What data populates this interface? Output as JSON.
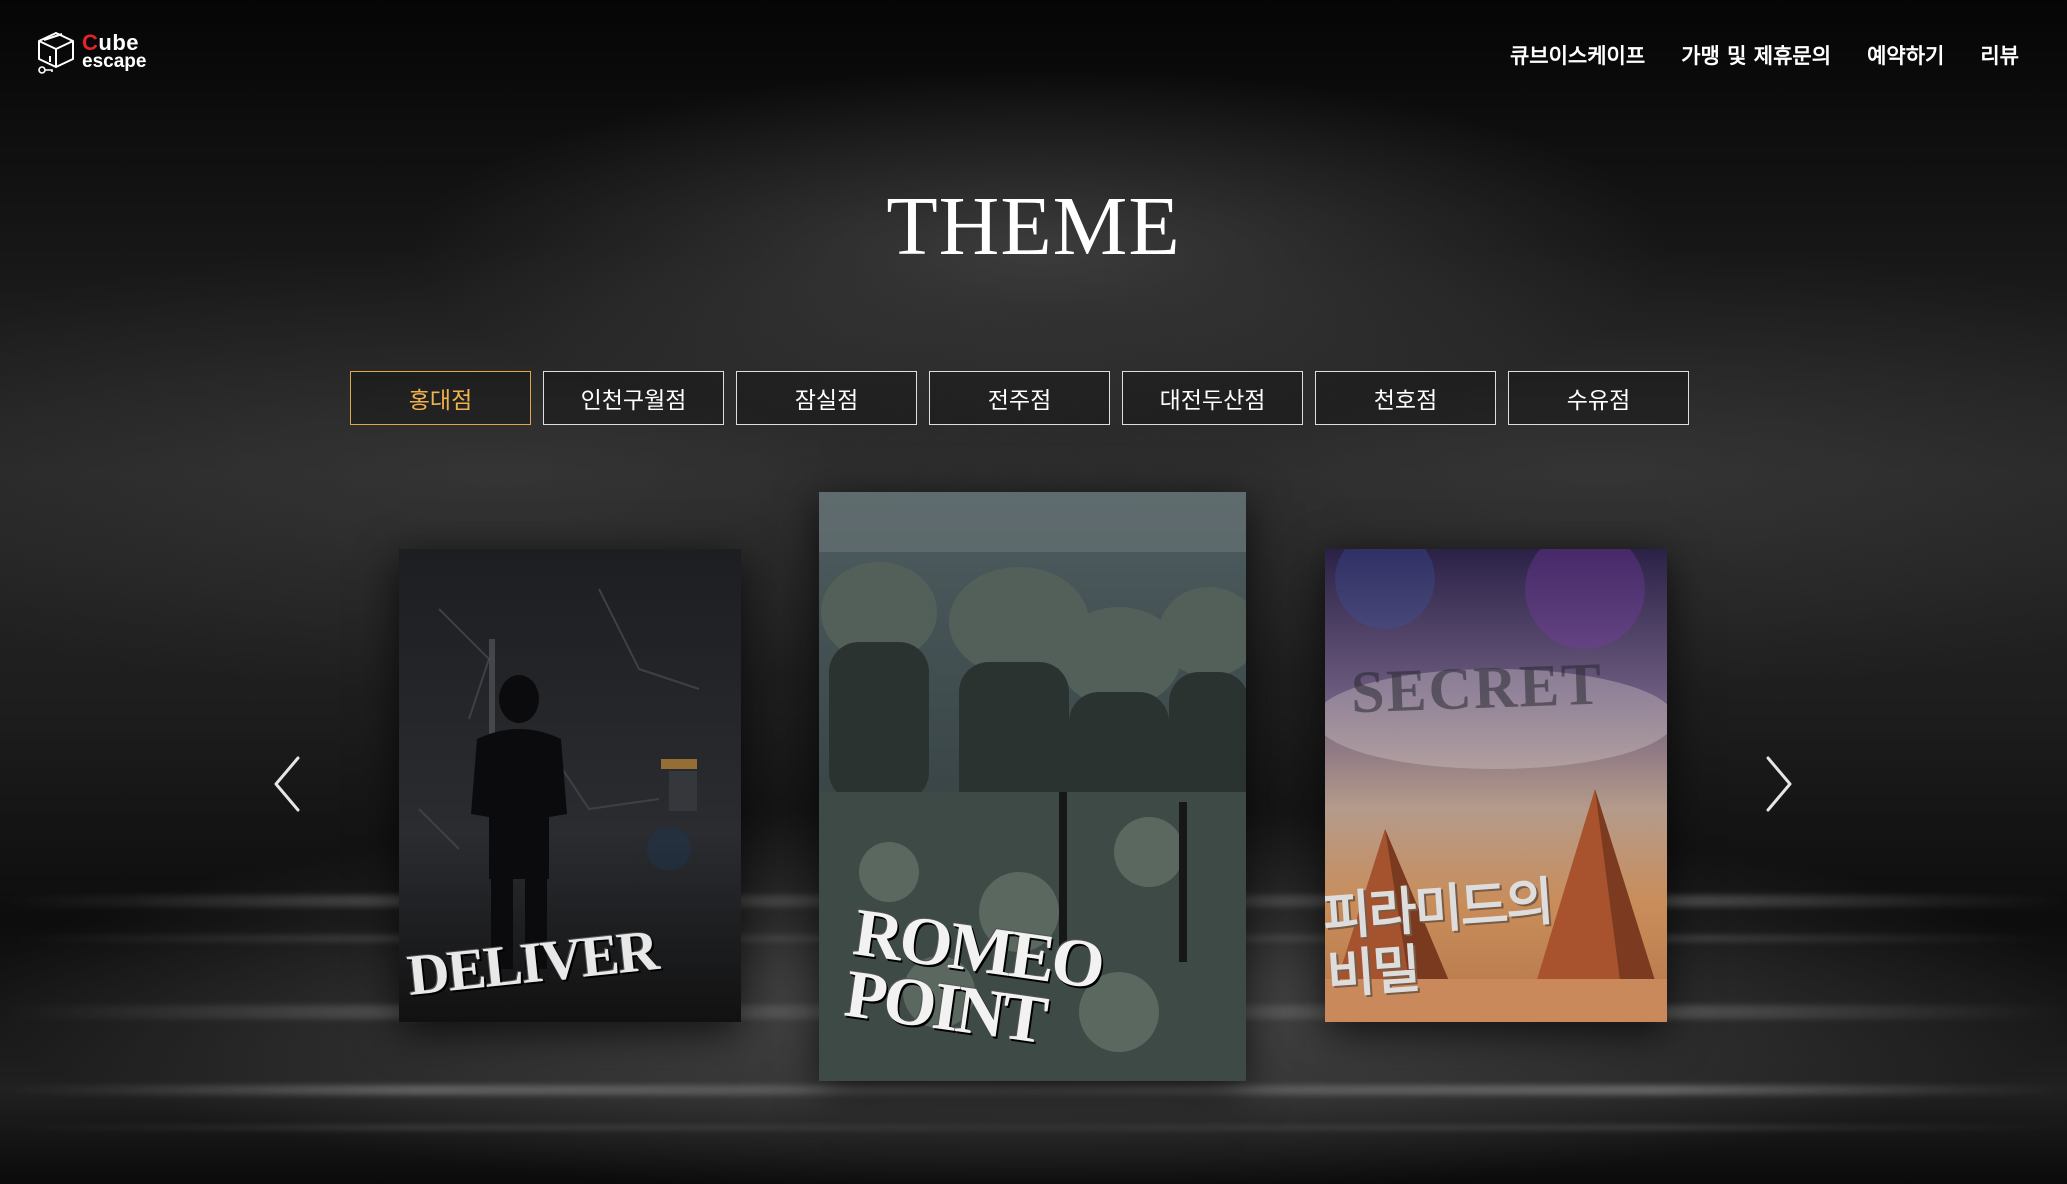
{
  "header": {
    "logo": {
      "line1": "Cube",
      "line2": "escape"
    },
    "nav": [
      {
        "label": "큐브이스케이프"
      },
      {
        "label": "가맹 및 제휴문의"
      },
      {
        "label": "예약하기"
      },
      {
        "label": "리뷰"
      }
    ]
  },
  "main": {
    "title": "THEME",
    "branches": [
      {
        "label": "홍대점",
        "active": true
      },
      {
        "label": "인천구월점",
        "active": false
      },
      {
        "label": "잠실점",
        "active": false
      },
      {
        "label": "전주점",
        "active": false
      },
      {
        "label": "대전두산점",
        "active": false
      },
      {
        "label": "천호점",
        "active": false
      },
      {
        "label": "수유점",
        "active": false
      }
    ],
    "carousel": {
      "prev_icon": "chevron-left-icon",
      "next_icon": "chevron-right-icon",
      "posters": [
        {
          "title": "DELIVER",
          "position": "left"
        },
        {
          "title": "ROMEO\nPOINT",
          "position": "center"
        },
        {
          "subtitle": "SECRET",
          "title": "피라미드의\n비밀",
          "position": "right"
        }
      ]
    }
  },
  "colors": {
    "accent": "#e2a547",
    "logo_red": "#e2232a",
    "text": "#ffffff"
  }
}
